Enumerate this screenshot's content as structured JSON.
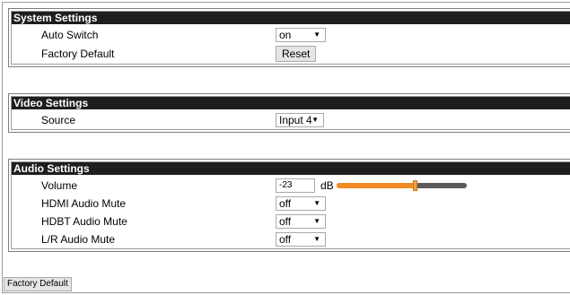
{
  "system": {
    "title": "System Settings",
    "auto_switch_label": "Auto Switch",
    "auto_switch_value": "on",
    "factory_default_label": "Factory Default",
    "reset_label": "Reset"
  },
  "video": {
    "title": "Video Settings",
    "source_label": "Source",
    "source_value": "Input 4"
  },
  "audio": {
    "title": "Audio Settings",
    "volume_label": "Volume",
    "volume_value": "-23",
    "volume_unit": "dB",
    "volume_slider_fraction": 0.6,
    "hdmi_mute_label": "HDMI Audio Mute",
    "hdmi_mute_value": "off",
    "hdbt_mute_label": "HDBT Audio Mute",
    "hdbt_mute_value": "off",
    "lr_mute_label": "L/R Audio Mute",
    "lr_mute_value": "off"
  },
  "footer": {
    "factory_default_button": "Factory Default"
  },
  "icons": {
    "dropdown_arrow": "▼"
  },
  "colors": {
    "header_bg": "#1e1e1e",
    "slider_fill": "#f08a24",
    "slider_track": "#5a5a5a"
  }
}
